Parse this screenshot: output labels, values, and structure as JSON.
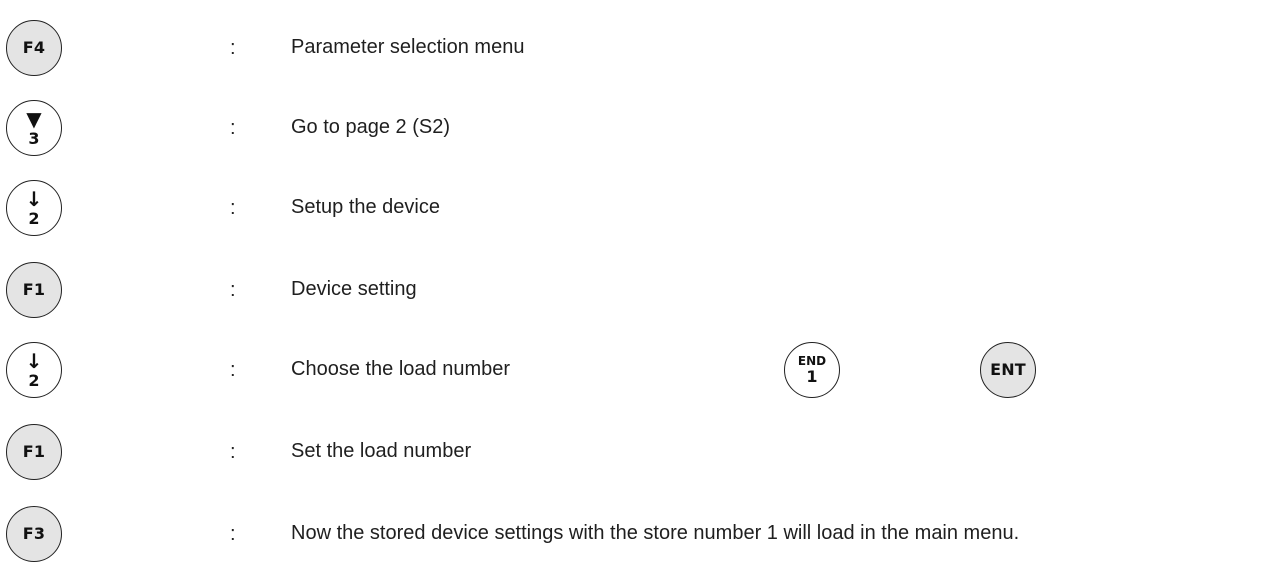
{
  "steps": [
    {
      "key_label": "F4",
      "colon": ":",
      "description": "Parameter selection menu"
    },
    {
      "key_symbol": "▼",
      "key_number": "3",
      "colon": ":",
      "description": "Go to page 2 (S2)"
    },
    {
      "key_symbol": "↓",
      "key_number": "2",
      "colon": ":",
      "description": "Setup the device"
    },
    {
      "key_label": "F1",
      "colon": ":",
      "description": "Device setting"
    },
    {
      "key_symbol": "↓",
      "key_number": "2",
      "colon": ":",
      "description": "Choose the load number"
    },
    {
      "key_label": "F1",
      "colon": ":",
      "description": "Set the load number"
    },
    {
      "key_label": "F3",
      "colon": ":",
      "description": "Now the stored device settings with the store number 1 will load in the main menu."
    }
  ],
  "extra_keys": {
    "end_key_top": "END",
    "end_key_number": "1",
    "ent_key_label": "ENT"
  }
}
